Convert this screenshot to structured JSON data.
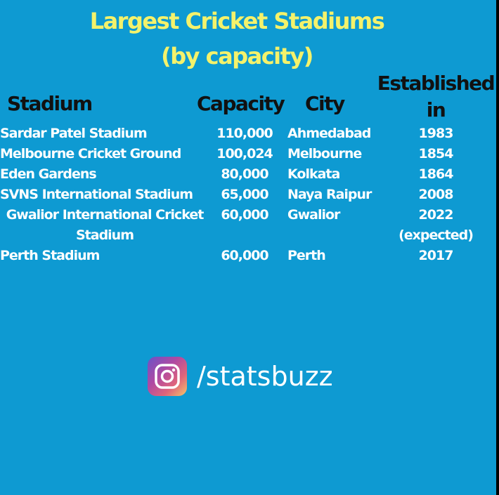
{
  "title": {
    "line1": "Largest Cricket Stadiums",
    "line2": "(by capacity)"
  },
  "headers": {
    "stadium": "Stadium",
    "capacity": "Capacity",
    "city": "City",
    "established": "Established in"
  },
  "rows": [
    {
      "stadium": "Sardar Patel Stadium",
      "capacity": "110,000",
      "city": "Ahmedabad",
      "established": "1983"
    },
    {
      "stadium": "Melbourne Cricket Ground",
      "capacity": "100,024",
      "city": "Melbourne",
      "established": "1854"
    },
    {
      "stadium": "Eden Gardens",
      "capacity": "80,000",
      "city": "Kolkata",
      "established": "1864"
    },
    {
      "stadium": "SVNS International Stadium",
      "capacity": "65,000",
      "city": "Naya Raipur",
      "established": "2008"
    },
    {
      "stadium": "Gwalior International Cricket Stadium",
      "capacity": "60,000",
      "city": "Gwalior",
      "established": "2022 (expected)"
    },
    {
      "stadium": "Perth Stadium",
      "capacity": "60,000",
      "city": "Perth",
      "established": "2017"
    }
  ],
  "social": {
    "icon": "instagram-icon",
    "handle": "/statsbuzz"
  },
  "colors": {
    "background": "#0e9ad2",
    "title": "#f4f26b",
    "header_text": "#111111",
    "row_text": "#ffffff"
  }
}
